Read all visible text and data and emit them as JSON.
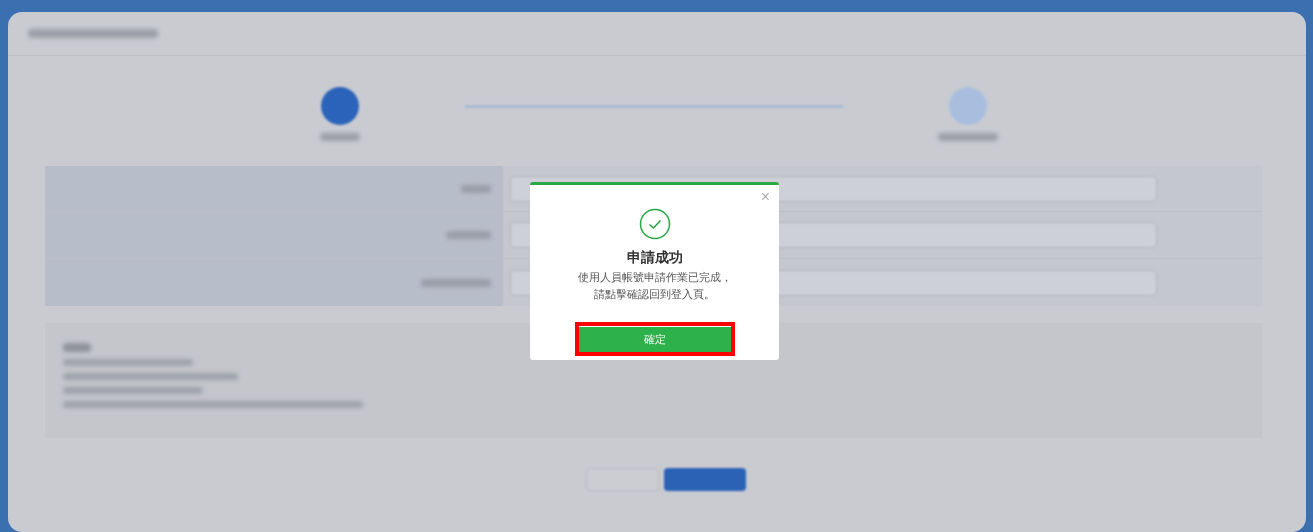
{
  "dialog": {
    "title": "申請成功",
    "message_lines": [
      "使用人員帳號申請作業已完成，",
      "請點擊確認回到登入頁。"
    ],
    "close": "×",
    "confirm_button": {
      "label": "確定",
      "highlighted": true
    }
  }
}
